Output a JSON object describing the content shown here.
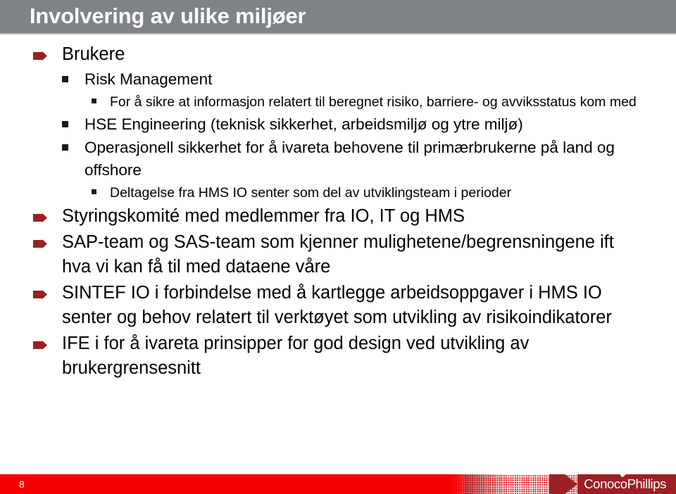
{
  "slide": {
    "title": "Involvering av ulike miljøer",
    "title_bar_color": "#7f8286",
    "accent_color": "#9c1f24",
    "footer_color": "#f40000"
  },
  "bullets": [
    {
      "level": 1,
      "text": "Brukere"
    },
    {
      "level": 2,
      "text": "Risk Management"
    },
    {
      "level": 3,
      "text": "For å sikre at informasjon relatert til beregnet risiko, barriere- og avviksstatus kom med"
    },
    {
      "level": 2,
      "text": "HSE Engineering (teknisk sikkerhet, arbeidsmiljø og ytre miljø)"
    },
    {
      "level": 2,
      "text": "Operasjonell sikkerhet for å ivareta behovene til primærbrukerne på land og offshore"
    },
    {
      "level": 3,
      "text": "Deltagelse fra HMS IO senter som del av utviklingsteam i perioder"
    },
    {
      "level": 1,
      "text": "Styringskomité med medlemmer fra IO, IT og HMS"
    },
    {
      "level": 1,
      "text": "SAP-team og SAS-team som kjenner mulighetene/begrensningene ift hva vi kan få til med dataene våre"
    },
    {
      "level": 1,
      "text": "SINTEF IO i forbindelse med å kartlegge arbeidsoppgaver i HMS IO senter og behov relatert til verktøyet som utvikling av risikoindikatorer"
    },
    {
      "level": 1,
      "text": "IFE i for å ivareta prinsipper for god design ved utvikling av brukergrensesnitt"
    }
  ],
  "footer": {
    "page_number": "8",
    "logo_text": "ConocoPhillips",
    "logo_icon": "swoosh-icon"
  }
}
